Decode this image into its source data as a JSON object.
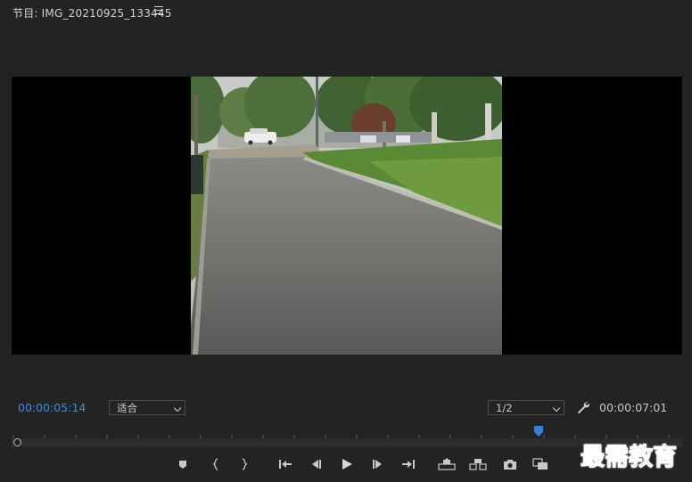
{
  "panel": {
    "title": "节目: IMG_20210925_133445",
    "menu_icon": "hamburger-menu-icon"
  },
  "controls": {
    "current_timecode": "00:00:05:14",
    "zoom_value": "适合",
    "resolution_value": "1/2",
    "duration_timecode": "00:00:07:01",
    "settings_icon": "wrench-icon"
  },
  "timeline": {
    "playhead_fraction": 0.786
  },
  "transport": {
    "buttons": [
      "add-marker-icon",
      "mark-in-icon",
      "mark-out-icon",
      "go-to-in-icon",
      "step-back-icon",
      "play-icon",
      "step-forward-icon",
      "go-to-out-icon",
      "lift-icon",
      "extract-icon",
      "export-frame-icon",
      "comparison-view-icon"
    ]
  },
  "watermark": {
    "text": "最需教育"
  },
  "colors": {
    "accent": "#3a8ee6",
    "background": "#232323",
    "viewer_bg": "#000000"
  }
}
